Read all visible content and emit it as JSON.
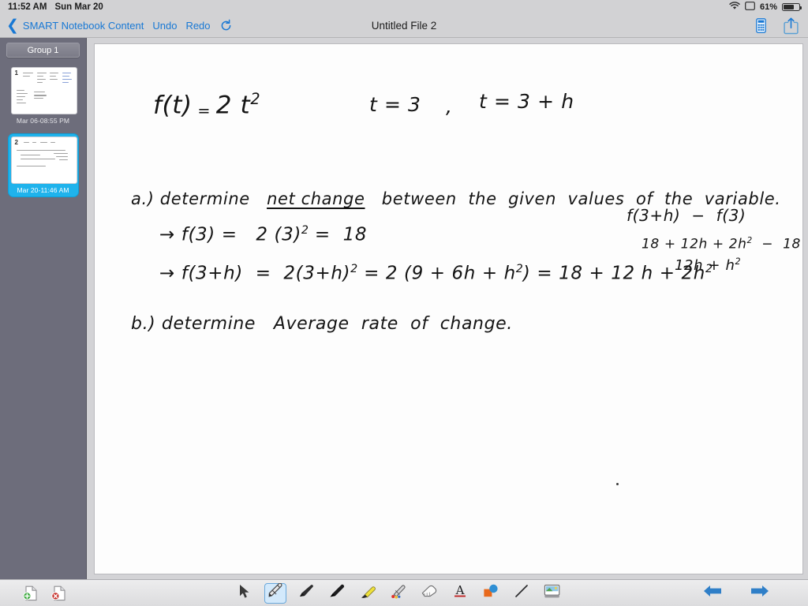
{
  "status_bar": {
    "time": "11:52 AM",
    "date": "Sun Mar 20",
    "battery_percent": "61%",
    "battery_level": 61,
    "icons": [
      "wifi-icon",
      "screen-mirroring-icon",
      "battery-icon"
    ]
  },
  "toolbar": {
    "back_label": "SMART Notebook Content",
    "undo_label": "Undo",
    "redo_label": "Redo",
    "refresh_icon": "refresh-icon",
    "title": "Untitled File 2",
    "calculator_icon": "calculator-icon",
    "share_icon": "share-icon",
    "accent_color": "#1878d4"
  },
  "sidebar": {
    "group_label": "Group 1",
    "pages": [
      {
        "number": "1",
        "label": "Mar 06-08:55 PM",
        "selected": false
      },
      {
        "number": "2",
        "label": "Mar 20-11:46 AM",
        "selected": true
      }
    ],
    "selection_color": "#1fb3ec",
    "background_color": "#6d6d7b"
  },
  "canvas": {
    "background_color": "#fdfdfd",
    "ink_color": "#141414",
    "notes": [
      {
        "id": "function-definition",
        "text": "f(t) = 2 t²"
      },
      {
        "id": "t-value-1",
        "text": "t = 3"
      },
      {
        "id": "comma-separator",
        "text": ","
      },
      {
        "id": "t-value-2",
        "text": "t = 3 + h"
      },
      {
        "id": "part-a-prompt-start",
        "text": "a.) determine"
      },
      {
        "id": "part-a-underlined-term",
        "text": "net change"
      },
      {
        "id": "part-a-prompt-end",
        "text": "between  the  given  values  of  the  variable."
      },
      {
        "id": "step-f3",
        "text": "→ f(3) =   2 (3)² =  18"
      },
      {
        "id": "step-f3h",
        "text": "→ f(3+h)  =  2(3+h)² = 2 (9 + 6h + h²) = 18 + 12 h + 2h²"
      },
      {
        "id": "side-work-line-1",
        "text": "f(3+h)  −  f(3)"
      },
      {
        "id": "side-work-line-2",
        "text": "18 + 12h + 2h²  −  18"
      },
      {
        "id": "side-work-line-3",
        "text": "12h + h²"
      },
      {
        "id": "part-b-prompt",
        "text": "b.) determine   Average  rate  of  change."
      }
    ]
  },
  "bottom_bar": {
    "add_page_icon": "add-page-icon",
    "delete_page_icon": "delete-page-icon",
    "tools": [
      {
        "name": "select-tool",
        "icon": "cursor-arrow-icon",
        "selected": false
      },
      {
        "name": "pen-tool",
        "icon": "pen-icon",
        "selected": true
      },
      {
        "name": "calligraphy-pen-tool",
        "icon": "calligraphy-pen-icon",
        "selected": false
      },
      {
        "name": "marker-tool",
        "icon": "marker-icon",
        "selected": false
      },
      {
        "name": "highlighter-tool",
        "icon": "highlighter-icon",
        "selected": false
      },
      {
        "name": "creative-pen-tool",
        "icon": "creative-pen-icon",
        "selected": false
      },
      {
        "name": "eraser-tool",
        "icon": "eraser-icon",
        "selected": false
      },
      {
        "name": "text-tool",
        "icon": "text-a-icon",
        "selected": false
      },
      {
        "name": "shapes-tool",
        "icon": "shapes-icon",
        "selected": false
      },
      {
        "name": "line-tool",
        "icon": "line-icon",
        "selected": false
      },
      {
        "name": "image-tool",
        "icon": "image-icon",
        "selected": false
      }
    ],
    "prev_page_icon": "arrow-left-icon",
    "next_page_icon": "arrow-right-icon"
  }
}
